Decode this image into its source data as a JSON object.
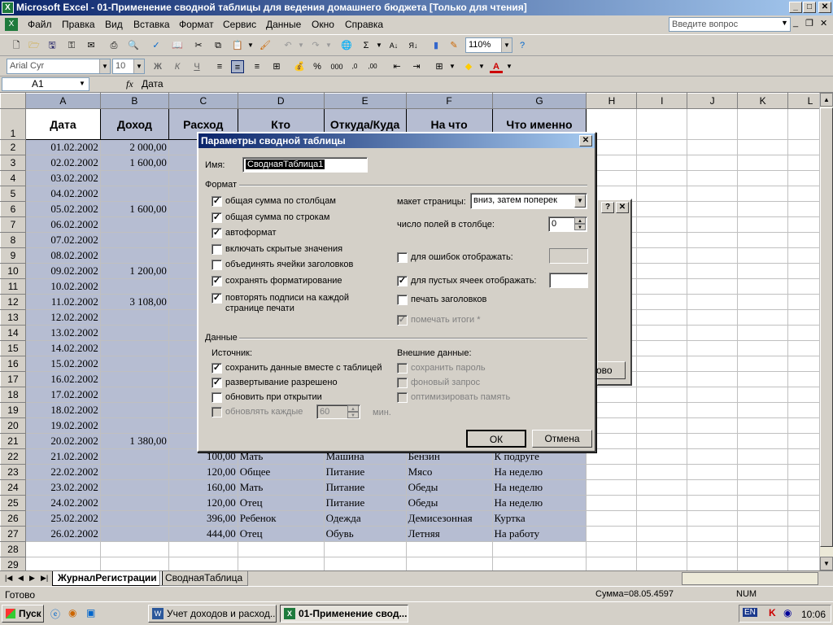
{
  "window": {
    "title": "Microsoft Excel - 01-Применение сводной таблицы для ведения домашнего бюджета  [Только для чтения]"
  },
  "menu": [
    "Файл",
    "Правка",
    "Вид",
    "Вставка",
    "Формат",
    "Сервис",
    "Данные",
    "Окно",
    "Справка"
  ],
  "help_placeholder": "Введите вопрос",
  "toolbar": {
    "zoom": "110%"
  },
  "format_toolbar": {
    "font": "Arial Cyr",
    "size": "10",
    "bold": "Ж",
    "italic": "К",
    "underline": "Ч",
    "thousands": "000",
    "percent": "%"
  },
  "formula": {
    "cell_ref": "A1",
    "fx": "fx",
    "value": "Дата"
  },
  "columns": [
    "A",
    "B",
    "C",
    "D",
    "E",
    "F",
    "G",
    "H",
    "I",
    "J",
    "K",
    "L"
  ],
  "headers": [
    "Дата",
    "Доход",
    "Расход",
    "Кто",
    "Откуда/Куда",
    "На что",
    "Что именно"
  ],
  "rows": [
    {
      "n": "1"
    },
    {
      "n": "2",
      "a": "01.02.2002",
      "b": "2 000,00"
    },
    {
      "n": "3",
      "a": "02.02.2002",
      "b": "1 600,00"
    },
    {
      "n": "4",
      "a": "03.02.2002"
    },
    {
      "n": "5",
      "a": "04.02.2002"
    },
    {
      "n": "6",
      "a": "05.02.2002",
      "b": "1 600,00"
    },
    {
      "n": "7",
      "a": "06.02.2002"
    },
    {
      "n": "8",
      "a": "07.02.2002"
    },
    {
      "n": "9",
      "a": "08.02.2002"
    },
    {
      "n": "10",
      "a": "09.02.2002",
      "b": "1 200,00"
    },
    {
      "n": "11",
      "a": "10.02.2002"
    },
    {
      "n": "12",
      "a": "11.02.2002",
      "b": "3 108,00"
    },
    {
      "n": "13",
      "a": "12.02.2002"
    },
    {
      "n": "14",
      "a": "13.02.2002"
    },
    {
      "n": "15",
      "a": "14.02.2002"
    },
    {
      "n": "16",
      "a": "15.02.2002"
    },
    {
      "n": "17",
      "a": "16.02.2002"
    },
    {
      "n": "18",
      "a": "17.02.2002"
    },
    {
      "n": "19",
      "a": "18.02.2002"
    },
    {
      "n": "20",
      "a": "19.02.2002"
    },
    {
      "n": "21",
      "a": "20.02.2002",
      "b": "1 380,00"
    },
    {
      "n": "22",
      "a": "21.02.2002",
      "c": "100,00",
      "d": "Мать",
      "e": "Машина",
      "f": "Бензин",
      "g": "К подруге"
    },
    {
      "n": "23",
      "a": "22.02.2002",
      "c": "120,00",
      "d": "Общее",
      "e": "Питание",
      "f": "Мясо",
      "g": "На неделю"
    },
    {
      "n": "24",
      "a": "23.02.2002",
      "c": "160,00",
      "d": "Мать",
      "e": "Питание",
      "f": "Обеды",
      "g": "На неделю"
    },
    {
      "n": "25",
      "a": "24.02.2002",
      "c": "120,00",
      "d": "Отец",
      "e": "Питание",
      "f": "Обеды",
      "g": "На неделю"
    },
    {
      "n": "26",
      "a": "25.02.2002",
      "c": "396,00",
      "d": "Ребенок",
      "e": "Одежда",
      "f": "Демисезонная",
      "g": "Куртка"
    },
    {
      "n": "27",
      "a": "26.02.2002",
      "c": "444,00",
      "d": "Отец",
      "e": "Обувь",
      "f": "Летняя",
      "g": "На работу"
    },
    {
      "n": "28"
    },
    {
      "n": "29"
    }
  ],
  "sheet_tabs": [
    "ЖурналРегистрации",
    "СводнаяТаблица"
  ],
  "status": {
    "left": "Готово",
    "sum": "Сумма=08.05.4597",
    "num": "NUM"
  },
  "taskbar": {
    "start": "Пуск",
    "task1": "Учет доходов и расход...",
    "task2": "01-Применение свод...",
    "lang": "EN",
    "clock": "10:06"
  },
  "behind_dialog": {
    "button_fragment": "ово"
  },
  "dialog": {
    "title": "Параметры сводной таблицы",
    "name_label": "Имя:",
    "name_value": "СводнаяТаблица1",
    "format_section": "Формат",
    "left_options": [
      {
        "label": "общая сумма по столбцам",
        "checked": true
      },
      {
        "label": "общая сумма по строкам",
        "checked": true
      },
      {
        "label": "автоформат",
        "checked": true
      },
      {
        "label": "включать скрытые значения",
        "checked": false
      },
      {
        "label": "объединять ячейки заголовков",
        "checked": false
      },
      {
        "label": "сохранять форматирование",
        "checked": true
      },
      {
        "label": "повторять подписи на каждой",
        "label2": "странице печати",
        "checked": true
      }
    ],
    "layout_label": "макет страницы:",
    "layout_value": "вниз, затем поперек",
    "fields_per_col_label": "число полей в столбце:",
    "fields_per_col_value": "0",
    "right_options": [
      {
        "label": "для ошибок отображать:",
        "checked": false,
        "disabled": false
      },
      {
        "label": "для пустых ячеек отображать:",
        "checked": true,
        "disabled": false
      },
      {
        "label": "печать заголовков",
        "checked": false,
        "disabled": false
      },
      {
        "label": "помечать итоги *",
        "checked": true,
        "disabled": true
      }
    ],
    "data_section": "Данные",
    "source_label": "Источник:",
    "source_options": [
      {
        "label": "сохранить данные вместе с таблицей",
        "checked": true,
        "disabled": false
      },
      {
        "label": "развертывание разрешено",
        "checked": true,
        "disabled": false
      },
      {
        "label": "обновить при открытии",
        "checked": false,
        "disabled": false
      },
      {
        "label": "обновлять каждые",
        "checked": false,
        "disabled": true
      }
    ],
    "refresh_value": "60",
    "minutes_label": "мин.",
    "external_label": "Внешние данные:",
    "external_options": [
      {
        "label": "сохранить пароль",
        "checked": false
      },
      {
        "label": "фоновый запрос",
        "checked": false
      },
      {
        "label": "оптимизировать память",
        "checked": false
      }
    ],
    "ok": "ОК",
    "cancel": "Отмена"
  }
}
